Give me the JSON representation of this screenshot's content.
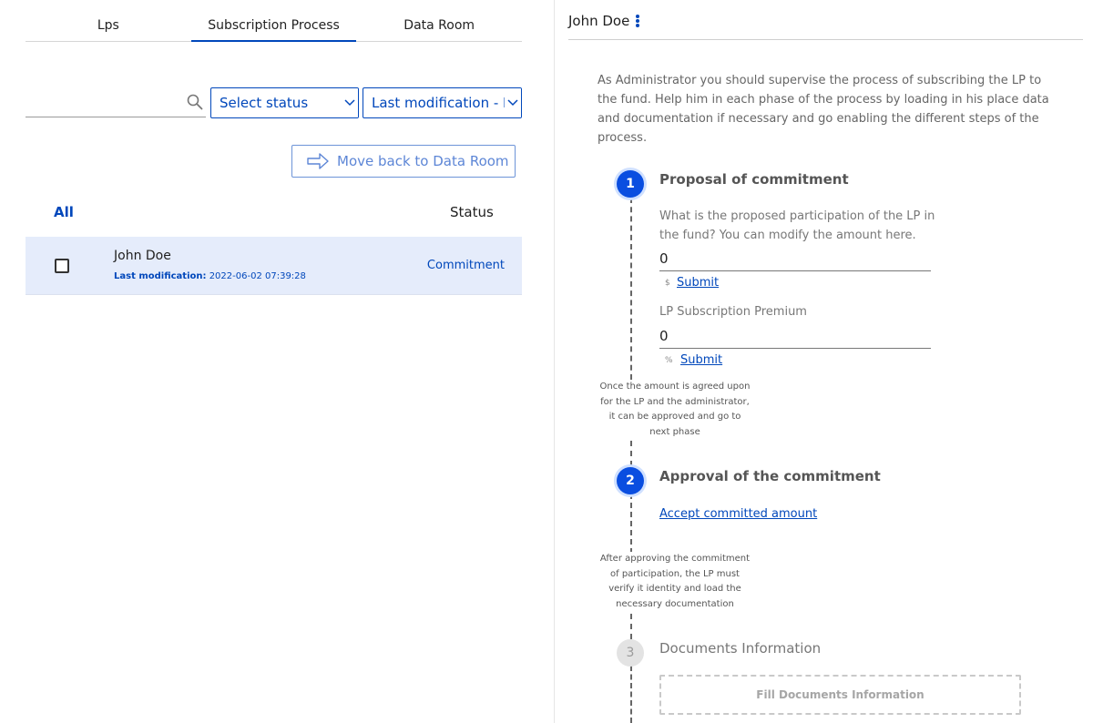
{
  "tabs": [
    {
      "label": "Lps"
    },
    {
      "label": "Subscription Process"
    },
    {
      "label": "Data Room"
    }
  ],
  "filters": {
    "search_placeholder": "",
    "status_select": "Select status",
    "modification_select": "Last modification - D"
  },
  "move_button": {
    "label": "Move back to Data Room"
  },
  "list_header": {
    "all": "All",
    "status": "Status"
  },
  "rows": [
    {
      "name": "John Doe",
      "modification_label": "Last modification:",
      "modification_value": "2022-06-02 07:39:28",
      "status": "Commitment"
    }
  ],
  "detail": {
    "title": "John Doe",
    "intro": "As Administrator you should supervise the process of subscribing the LP to the fund. Help him in each phase of the process by loading in his place data and documentation if necessary and go enabling the different steps of the process.",
    "steps": [
      {
        "number": "1",
        "title": "Proposal of commitment",
        "question": "What is the proposed participation of the LP in the fund? You can modify the amount here.",
        "amount_value": "0",
        "amount_unit": "$",
        "amount_submit": "Submit",
        "premium_label": "LP Subscription Premium",
        "premium_value": "0",
        "premium_unit": "%",
        "premium_submit": "Submit",
        "note": "Once the amount is agreed upon for the LP and the administrator, it can be approved and go to next phase"
      },
      {
        "number": "2",
        "title": "Approval of the commitment",
        "action": "Accept committed amount",
        "note": "After approving the commitment of participation, the LP must verify it identity and load the necessary documentation"
      },
      {
        "number": "3",
        "title": "Documents Information",
        "action": "Fill Documents Information"
      }
    ]
  },
  "colors": {
    "accent": "#0047bb",
    "active_step": "#0a4ee0",
    "selected_row": "#e5ecfb"
  },
  "icons": [
    "search-icon",
    "chevron-down-icon",
    "arrow-right-icon",
    "kebab-menu-icon",
    "checkbox"
  ]
}
